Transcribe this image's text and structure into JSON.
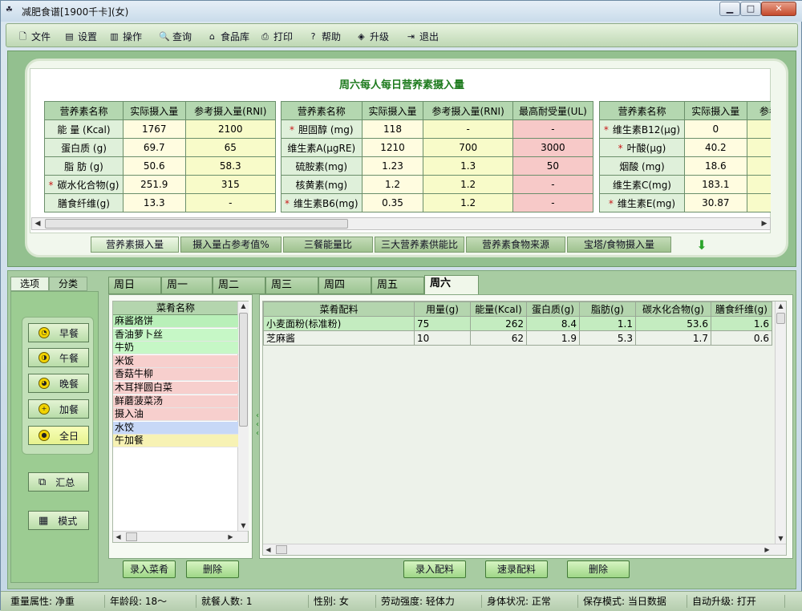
{
  "window": {
    "title": "减肥食谱[1900千卡](女)",
    "app_icon": "app-logo-icon",
    "min": "▁",
    "max": "□",
    "close": "✕"
  },
  "menu": [
    {
      "label": "文件",
      "icon": "file-icon",
      "glyph": "🗋"
    },
    {
      "label": "设置",
      "icon": "settings-icon",
      "glyph": "▤"
    },
    {
      "label": "操作",
      "icon": "chart-icon",
      "glyph": "▥"
    },
    {
      "label": "查询",
      "icon": "search-icon",
      "glyph": "🔍"
    },
    {
      "label": "食品库",
      "icon": "house-icon",
      "glyph": "⌂"
    },
    {
      "label": "打印",
      "icon": "printer-icon",
      "glyph": "⎙"
    },
    {
      "label": "帮助",
      "icon": "help-icon",
      "glyph": "?"
    },
    {
      "label": "升级",
      "icon": "upgrade-icon",
      "glyph": "◈"
    },
    {
      "label": "退出",
      "icon": "exit-icon",
      "glyph": "⇥"
    }
  ],
  "report": {
    "title": "周六每人每日营养素摄入量",
    "table1": {
      "headers": [
        "营养素名称",
        "实际摄入量",
        "参考摄入量(RNI)"
      ],
      "rows": [
        {
          "star": false,
          "name": "能 量 (Kcal)",
          "actual": "1767",
          "rni": "2100"
        },
        {
          "star": false,
          "name": "蛋白质 (g)",
          "actual": "69.7",
          "rni": "65"
        },
        {
          "star": false,
          "name": "脂 肪 (g)",
          "actual": "50.6",
          "rni": "58.3"
        },
        {
          "star": true,
          "name": "碳水化合物(g)",
          "actual": "251.9",
          "rni": "315"
        },
        {
          "star": false,
          "name": "膳食纤维(g)",
          "actual": "13.3",
          "rni": "-"
        }
      ]
    },
    "table2": {
      "headers": [
        "营养素名称",
        "实际摄入量",
        "参考摄入量(RNI)",
        "最高耐受量(UL)"
      ],
      "rows": [
        {
          "star": true,
          "name": "胆固醇 (mg)",
          "actual": "118",
          "rni": "-",
          "ul": "-"
        },
        {
          "star": false,
          "name": "维生素A(μgRE)",
          "actual": "1210",
          "rni": "700",
          "ul": "3000"
        },
        {
          "star": false,
          "name": "硫胺素(mg)",
          "actual": "1.23",
          "rni": "1.3",
          "ul": "50"
        },
        {
          "star": false,
          "name": "核黄素(mg)",
          "actual": "1.2",
          "rni": "1.2",
          "ul": "-"
        },
        {
          "star": true,
          "name": "维生素B6(mg)",
          "actual": "0.35",
          "rni": "1.2",
          "ul": "-"
        }
      ]
    },
    "table3": {
      "headers": [
        "营养素名称",
        "实际摄入量",
        "参考"
      ],
      "rows": [
        {
          "star": true,
          "name": "维生素B12(μg)",
          "actual": "0"
        },
        {
          "star": true,
          "name": "叶酸(μg)",
          "actual": "40.2"
        },
        {
          "star": false,
          "name": "烟酸 (mg)",
          "actual": "18.6"
        },
        {
          "star": false,
          "name": "维生素C(mg)",
          "actual": "183.1"
        },
        {
          "star": true,
          "name": "维生素E(mg)",
          "actual": "30.87"
        }
      ]
    }
  },
  "report_tabs": [
    "营养素摄入量",
    "摄入量占参考值%",
    "三餐能量比",
    "三大营养素供能比",
    "营养素食物来源",
    "宝塔/食物摄入量"
  ],
  "side_tabs": [
    "选项",
    "分类"
  ],
  "meals": [
    "早餐",
    "午餐",
    "晚餐",
    "加餐",
    "全日"
  ],
  "side_buttons": [
    "汇总",
    "模式"
  ],
  "days": [
    "周日",
    "周一",
    "周二",
    "周三",
    "周四",
    "周五",
    "周六"
  ],
  "dish_header": "菜肴名称",
  "dishes": [
    {
      "name": "麻酱烙饼",
      "color": "#b9f0b9"
    },
    {
      "name": "香油萝卜丝",
      "color": "#c6f7c6"
    },
    {
      "name": "牛奶",
      "color": "#c6f7c6"
    },
    {
      "name": "米饭",
      "color": "#f7cfcd"
    },
    {
      "name": "香菇牛柳",
      "color": "#f7cfcd"
    },
    {
      "name": "木耳拌圆白菜",
      "color": "#f7cfcd"
    },
    {
      "name": "鲜蘑菠菜汤",
      "color": "#f7cfcd"
    },
    {
      "name": "摄入油",
      "color": "#f7cfcd"
    },
    {
      "name": "水饺",
      "color": "#c7d8f7"
    },
    {
      "name": "午加餐",
      "color": "#f7f2b4"
    }
  ],
  "ing_headers": [
    "菜肴配料",
    "用量(g)",
    "能量(Kcal)",
    "蛋白质(g)",
    "脂肪(g)",
    "碳水化合物(g)",
    "膳食纤维(g)"
  ],
  "ingredients": [
    {
      "name": "小麦面粉(标准粉)",
      "amount": "75",
      "energy": "262",
      "protein": "8.4",
      "fat": "1.1",
      "carb": "53.6",
      "fiber": "1.6"
    },
    {
      "name": "芝麻酱",
      "amount": "10",
      "energy": "62",
      "protein": "1.9",
      "fat": "5.3",
      "carb": "1.7",
      "fiber": "0.6"
    }
  ],
  "buttons": {
    "add_dish": "录入菜肴",
    "delete_dish": "删除",
    "add_ing": "录入配料",
    "quick_ing": "速录配料",
    "delete_ing": "删除"
  },
  "status": [
    {
      "label": "重量属性: 净重"
    },
    {
      "label": "年龄段: 18～"
    },
    {
      "label": "就餐人数: 1"
    },
    {
      "label": "性别: 女"
    },
    {
      "label": "劳动强度: 轻体力"
    },
    {
      "label": "身体状况: 正常"
    },
    {
      "label": "保存模式: 当日数据"
    },
    {
      "label": "自动升级: 打开"
    }
  ]
}
